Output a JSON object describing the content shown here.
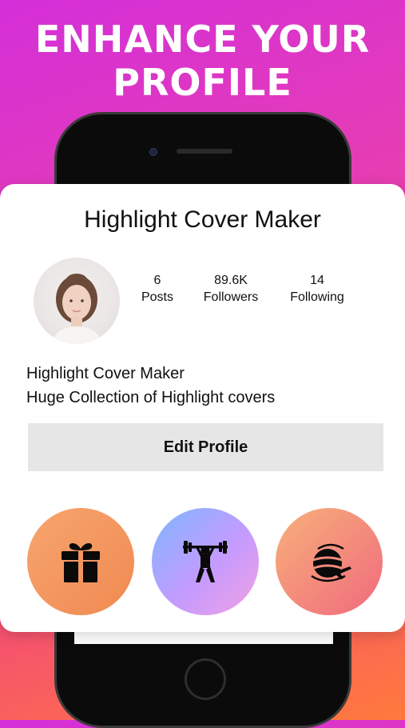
{
  "headline": {
    "line1": "ENHANCE YOUR",
    "line2": "PROFILE"
  },
  "profile": {
    "title": "Highlight Cover Maker",
    "stats": [
      {
        "value": "6",
        "label": "Posts"
      },
      {
        "value": "89.6K",
        "label": "Followers"
      },
      {
        "value": "14",
        "label": "Following"
      }
    ],
    "bio": [
      "Highlight Cover Maker",
      "Huge Collection of Highlight covers"
    ],
    "edit_button": "Edit Profile"
  },
  "highlights": [
    {
      "icon": "gift-icon",
      "color": "#f39460"
    },
    {
      "icon": "weightlifter-icon",
      "color": "#a9a6ff"
    },
    {
      "icon": "globe-airplane-icon",
      "color": "#f28a7a"
    }
  ]
}
